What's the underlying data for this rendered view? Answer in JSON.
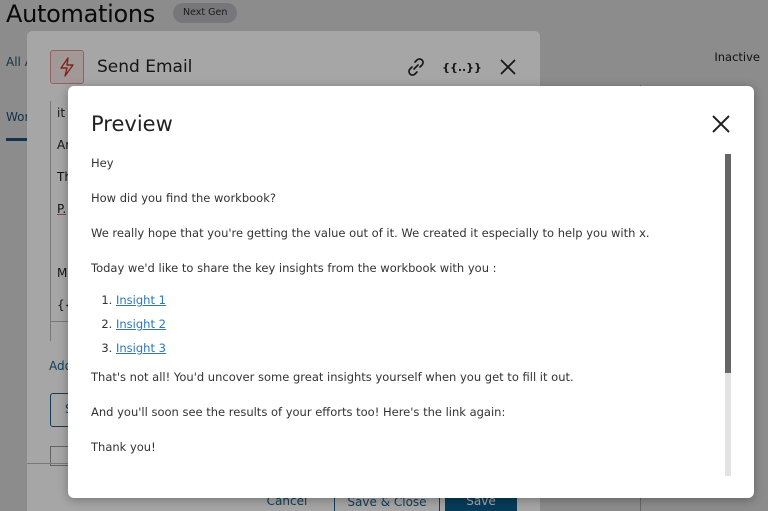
{
  "page": {
    "title": "Automations",
    "badge": "Next Gen",
    "tab_all": "All A",
    "tab_wor": "Wor",
    "status": "Inactive"
  },
  "send_email_dialog": {
    "title": "Send Email",
    "icon": "lightning-icon",
    "actions": [
      {
        "name": "link-icon",
        "label": ""
      },
      {
        "name": "variables-icon",
        "label": "{{..}}"
      },
      {
        "name": "close-icon",
        "label": ""
      }
    ],
    "editor_lines": [
      "it",
      "Ar",
      "Th",
      "P.",
      "M",
      "{{I"
    ],
    "add_link": "Add",
    "outline_button": "S",
    "footer": {
      "cancel": "Cancel",
      "save_close": "Save & Close",
      "save": "Save"
    }
  },
  "preview": {
    "title": "Preview",
    "paragraphs_before": [
      "Hey",
      "How did you find the workbook?",
      "We really hope that you're getting the value out of it. We created it especially to help you with x.",
      "Today we'd like to share the key insights from the workbook with you :"
    ],
    "insights": [
      "Insight 1",
      "Insight 2",
      "Insight 3"
    ],
    "paragraphs_after": [
      "That's not all! You'd uncover some great insights yourself when you get to fill it out.",
      "And you'll soon see the results of your efforts too! Here's the link again:",
      "Thank you!"
    ],
    "scroll_position": 0.0,
    "scroll_visible_fraction": 0.68,
    "colors": {
      "link": "#2b77b8",
      "accent": "#0b5c8a",
      "alert": "#c0392b"
    }
  }
}
